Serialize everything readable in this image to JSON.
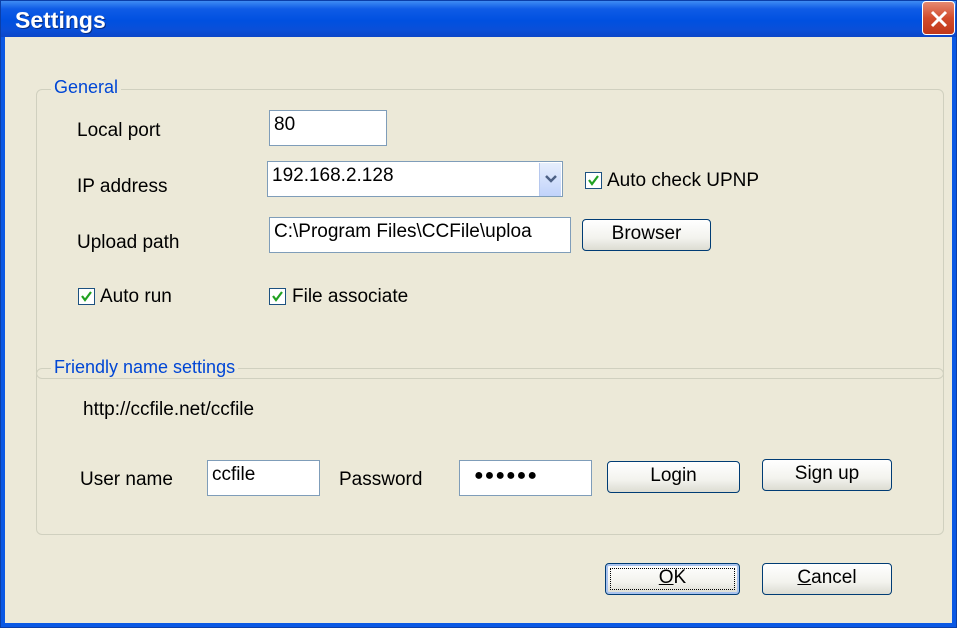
{
  "window": {
    "title": "Settings"
  },
  "general": {
    "legend": "General",
    "local_port": {
      "label": "Local port",
      "value": "80"
    },
    "ip_address": {
      "label": "IP address",
      "value": "192.168.2.128"
    },
    "auto_check_upnp": {
      "label": "Auto check UPNP",
      "checked": true
    },
    "upload_path": {
      "label": "Upload path",
      "value": "C:\\Program Files\\CCFile\\uploa",
      "browse_label": "Browser"
    },
    "auto_run": {
      "label": "Auto run",
      "checked": true
    },
    "file_associate": {
      "label": "File associate",
      "checked": true
    }
  },
  "friendly": {
    "legend": "Friendly name settings",
    "url": "http://ccfile.net/ccfile",
    "username": {
      "label": "User name",
      "value": "ccfile"
    },
    "password": {
      "label": "Password",
      "value": "●●●●●●"
    },
    "login_label": "Login",
    "signup_label": "Sign up"
  },
  "footer": {
    "ok": {
      "mnemonic": "O",
      "rest": "K"
    },
    "cancel": {
      "mnemonic": "C",
      "rest": "ancel"
    }
  },
  "colors": {
    "titlebar": "#0050e0",
    "legend": "#0046d5",
    "face": "#ece9d8"
  }
}
